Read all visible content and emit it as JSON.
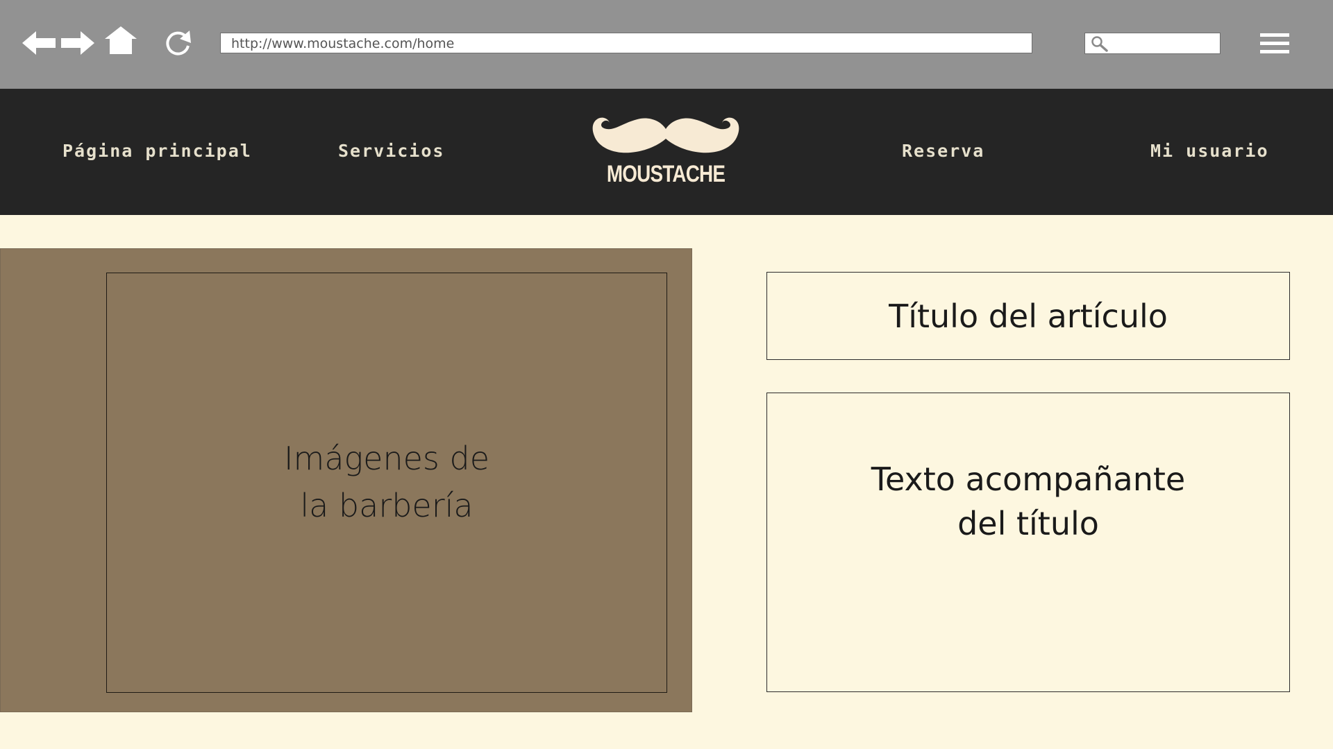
{
  "browser": {
    "url": "http://www.moustache.com/home",
    "search_placeholder": "",
    "icons": [
      "back-icon",
      "forward-icon",
      "home-icon",
      "refresh-icon",
      "search-icon",
      "menu-icon"
    ]
  },
  "site": {
    "logo_text": "MOUSTACHE",
    "nav": [
      {
        "label": "Página principal"
      },
      {
        "label": "Servicios"
      },
      {
        "label": "Reserva"
      },
      {
        "label": "Mi usuario"
      }
    ],
    "colors": {
      "header_bg": "#252525",
      "page_bg": "#fdf7e0",
      "panel_bg": "#8b775c",
      "logo": "#f7ead4"
    }
  },
  "main": {
    "image_caption": "Imágenes de\nla barbería",
    "article_title": "Título del artículo",
    "article_text": "Texto acompañante\ndel título"
  }
}
